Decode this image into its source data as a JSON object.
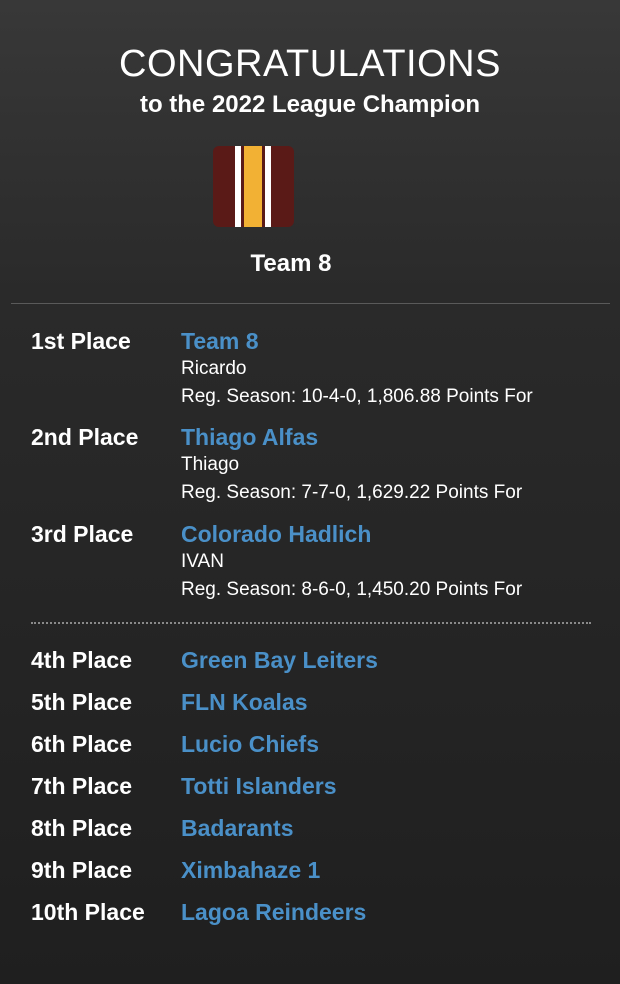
{
  "header": {
    "title": "CONGRATULATIONS",
    "subtitle": "to the 2022 League Champion"
  },
  "champion": {
    "name": "Team 8",
    "logo_colors": {
      "background": "#5a1a17",
      "stripe_white": "#ffffff",
      "stripe_gold": "#f2b134"
    }
  },
  "colors": {
    "team_link": "#4a90c8",
    "text": "#ffffff"
  },
  "podium": [
    {
      "place": "1st Place",
      "team": "Team 8",
      "owner": "Ricardo",
      "record": "Reg. Season: 10-4-0, 1,806.88 Points For"
    },
    {
      "place": "2nd Place",
      "team": "Thiago Alfas",
      "owner": "Thiago",
      "record": "Reg. Season: 7-7-0, 1,629.22 Points For"
    },
    {
      "place": "3rd Place",
      "team": "Colorado Hadlich",
      "owner": "IVAN",
      "record": "Reg. Season: 8-6-0, 1,450.20 Points For"
    }
  ],
  "standings": [
    {
      "place": "4th Place",
      "team": "Green Bay Leiters"
    },
    {
      "place": "5th Place",
      "team": "FLN Koalas"
    },
    {
      "place": "6th Place",
      "team": "Lucio Chiefs"
    },
    {
      "place": "7th Place",
      "team": "Totti Islanders"
    },
    {
      "place": "8th Place",
      "team": "Badarants"
    },
    {
      "place": "9th Place",
      "team": "Ximbahaze 1"
    },
    {
      "place": "10th Place",
      "team": "Lagoa Reindeers"
    }
  ]
}
